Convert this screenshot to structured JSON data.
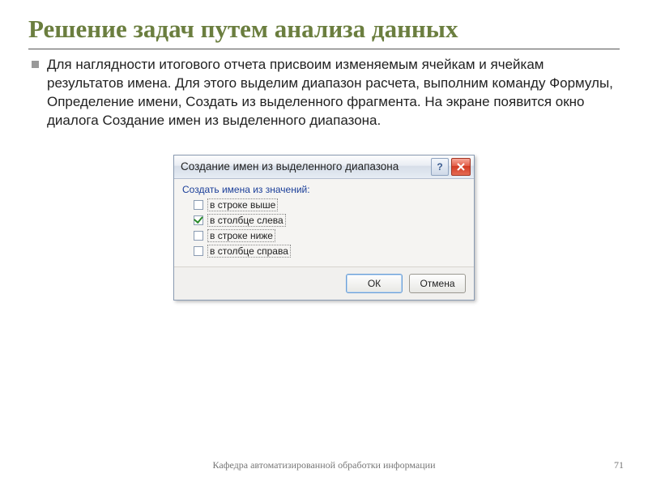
{
  "slide": {
    "title": "Решение задач путем анализа данных",
    "body": "Для наглядности итогового отчета присвоим изменяемым ячейкам и ячейкам результатов имена. Для этого выделим диапазон расчета, выполним команду Формулы, Определение имени, Создать из выделенного фрагмента.   На экране появится окно диалога Создание имен из выделенного диапазона.",
    "footer": "Кафедра автоматизированной обработки информации",
    "page_number": "71"
  },
  "dialog": {
    "title": "Создание имен из выделенного диапазона",
    "help_symbol": "?",
    "group_label": "Создать имена из значений:",
    "options": [
      {
        "label": "в строке выше",
        "checked": false
      },
      {
        "label": "в столбце слева",
        "checked": true
      },
      {
        "label": "в строке ниже",
        "checked": false
      },
      {
        "label": "в столбце справа",
        "checked": false
      }
    ],
    "ok": "ОК",
    "cancel": "Отмена"
  }
}
